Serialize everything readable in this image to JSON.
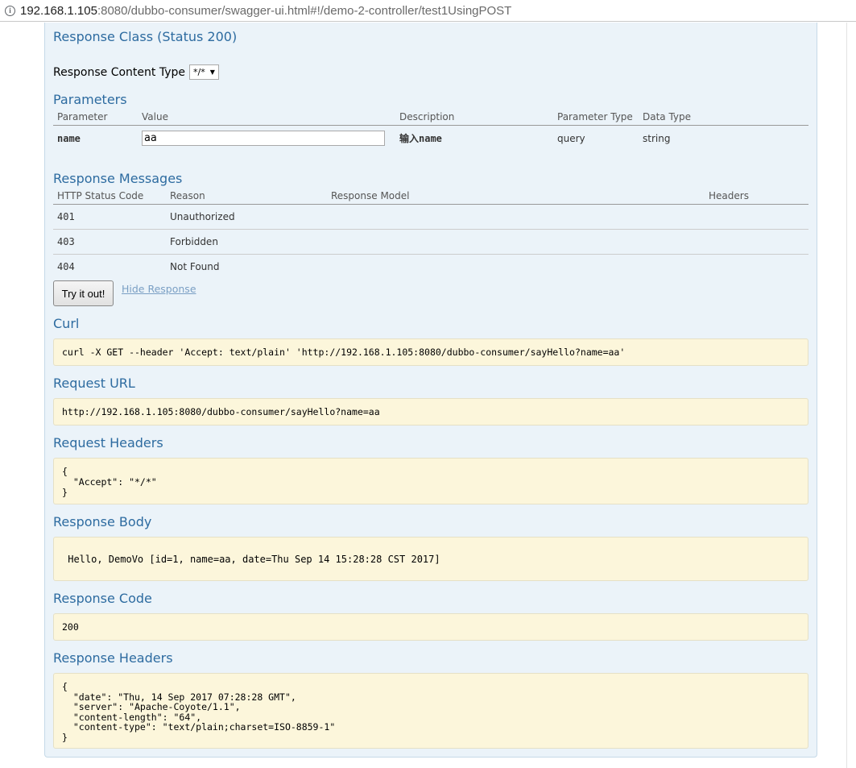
{
  "browser": {
    "url_host": "192.168.1.105",
    "url_rest": ":8080/dubbo-consumer/swagger-ui.html#!/demo-2-controller/test1UsingPOST"
  },
  "response_class": {
    "title": "Response Class (Status 200)"
  },
  "content_type": {
    "label": "Response Content Type",
    "selected": "*/*"
  },
  "parameters": {
    "title": "Parameters",
    "headers": [
      "Parameter",
      "Value",
      "Description",
      "Parameter Type",
      "Data Type"
    ],
    "rows": [
      {
        "name": "name",
        "value": "aa",
        "description": "输入name",
        "param_type": "query",
        "data_type": "string"
      }
    ]
  },
  "response_messages": {
    "title": "Response Messages",
    "headers": [
      "HTTP Status Code",
      "Reason",
      "Response Model",
      "Headers"
    ],
    "rows": [
      {
        "code": "401",
        "reason": "Unauthorized"
      },
      {
        "code": "403",
        "reason": "Forbidden"
      },
      {
        "code": "404",
        "reason": "Not Found"
      }
    ]
  },
  "actions": {
    "try_label": "Try it out!",
    "hide_label": "Hide Response"
  },
  "curl": {
    "title": "Curl",
    "text": "curl -X GET --header 'Accept: text/plain' 'http://192.168.1.105:8080/dubbo-consumer/sayHello?name=aa'"
  },
  "request_url": {
    "title": "Request URL",
    "text": "http://192.168.1.105:8080/dubbo-consumer/sayHello?name=aa"
  },
  "request_headers": {
    "title": "Request Headers",
    "text": "{\n  \"Accept\": \"*/*\"\n}"
  },
  "response_body": {
    "title": "Response Body",
    "text": " Hello, DemoVo [id=1, name=aa, date=Thu Sep 14 15:28:28 CST 2017]"
  },
  "response_code": {
    "title": "Response Code",
    "text": "200"
  },
  "response_headers": {
    "title": "Response Headers",
    "text": "{\n  \"date\": \"Thu, 14 Sep 2017 07:28:28 GMT\",\n  \"server\": \"Apache-Coyote/1.1\",\n  \"content-length\": \"64\",\n  \"content-type\": \"text/plain;charset=ISO-8859-1\"\n}"
  }
}
